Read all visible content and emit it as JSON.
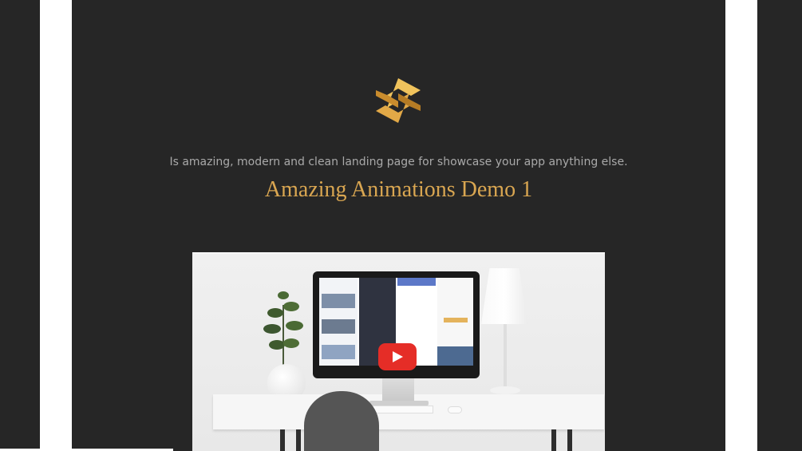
{
  "brand": {
    "logo_icon": "hexagon-s-logo-icon",
    "logo_colors": [
      "#f0c35c",
      "#c98c2d",
      "#e2a947"
    ]
  },
  "hero": {
    "tagline": "Is amazing, modern and clean landing page for showcase your app anything else.",
    "title": "Amazing Animations Demo 1"
  },
  "video": {
    "play_icon": "youtube-play-icon",
    "play_color": "#e52d27"
  },
  "colors": {
    "background": "#262626",
    "accent": "#d9a651",
    "tagline": "#a9a9a9"
  }
}
